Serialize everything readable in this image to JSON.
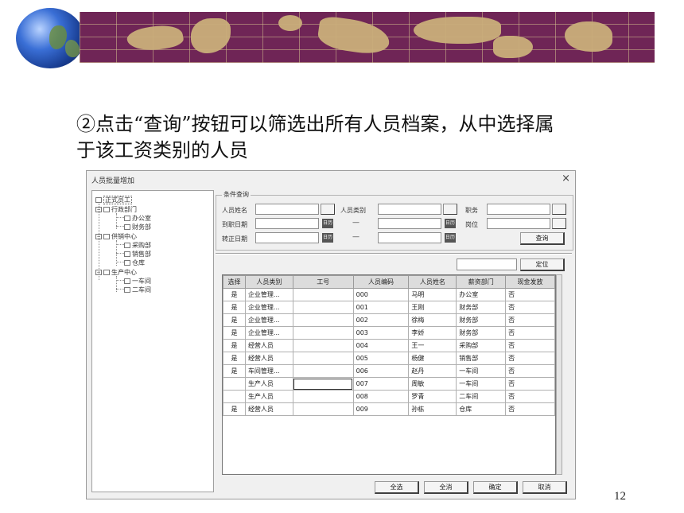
{
  "slide": {
    "line1": "②点击“查询”按钮可以筛选出所有人员档案，从中选择属",
    "line2": "于该工资类别的人员",
    "page_number": "12"
  },
  "dialog": {
    "title": "人员批量增加",
    "close": "×",
    "tree": {
      "root": "正式员工",
      "nodes": [
        {
          "label": "行政部门",
          "level": 1
        },
        {
          "label": "办公室",
          "level": 2
        },
        {
          "label": "财务部",
          "level": 2
        },
        {
          "label": "供销中心",
          "level": 1
        },
        {
          "label": "采购部",
          "level": 2
        },
        {
          "label": "销售部",
          "level": 2
        },
        {
          "label": "仓库",
          "level": 2
        },
        {
          "label": "生产中心",
          "level": 1
        },
        {
          "label": "一车间",
          "level": 2
        },
        {
          "label": "二车间",
          "level": 2
        }
      ]
    },
    "condition": {
      "legend": "条件查询",
      "name_label": "人员姓名",
      "category_label": "人员类别",
      "title_label": "职务",
      "hire_date_label": "到职日期",
      "position_label": "岗位",
      "regular_date_label": "转正日期",
      "dash": "—",
      "query_button": "查询",
      "calendar_glyph": "日历"
    },
    "locate_button": "定位",
    "grid": {
      "columns": [
        "选择",
        "人员类别",
        "工号",
        "人员编码",
        "人员姓名",
        "薪资部门",
        "现金发放"
      ],
      "rows": [
        [
          "是",
          "企业管理...",
          "",
          "000",
          "马明",
          "办公室",
          "否"
        ],
        [
          "是",
          "企业管理...",
          "",
          "001",
          "王刚",
          "财务部",
          "否"
        ],
        [
          "是",
          "企业管理...",
          "",
          "002",
          "徐梅",
          "财务部",
          "否"
        ],
        [
          "是",
          "企业管理...",
          "",
          "003",
          "李娇",
          "财务部",
          "否"
        ],
        [
          "是",
          "经营人员",
          "",
          "004",
          "王一",
          "采购部",
          "否"
        ],
        [
          "是",
          "经营人员",
          "",
          "005",
          "杨健",
          "销售部",
          "否"
        ],
        [
          "是",
          "车间管理...",
          "",
          "006",
          "赵丹",
          "一车间",
          "否"
        ],
        [
          "",
          "生产人员",
          "",
          "007",
          "周敏",
          "一车间",
          "否"
        ],
        [
          "",
          "生产人员",
          "",
          "008",
          "罗青",
          "二车间",
          "否"
        ],
        [
          "是",
          "经营人员",
          "",
          "009",
          "孙栋",
          "仓库",
          "否"
        ]
      ]
    },
    "buttons": {
      "select_all": "全选",
      "clear_all": "全消",
      "ok": "确定",
      "cancel": "取消"
    }
  },
  "colors": {
    "banner": "#6f2556",
    "land": "#c9ae7a"
  }
}
